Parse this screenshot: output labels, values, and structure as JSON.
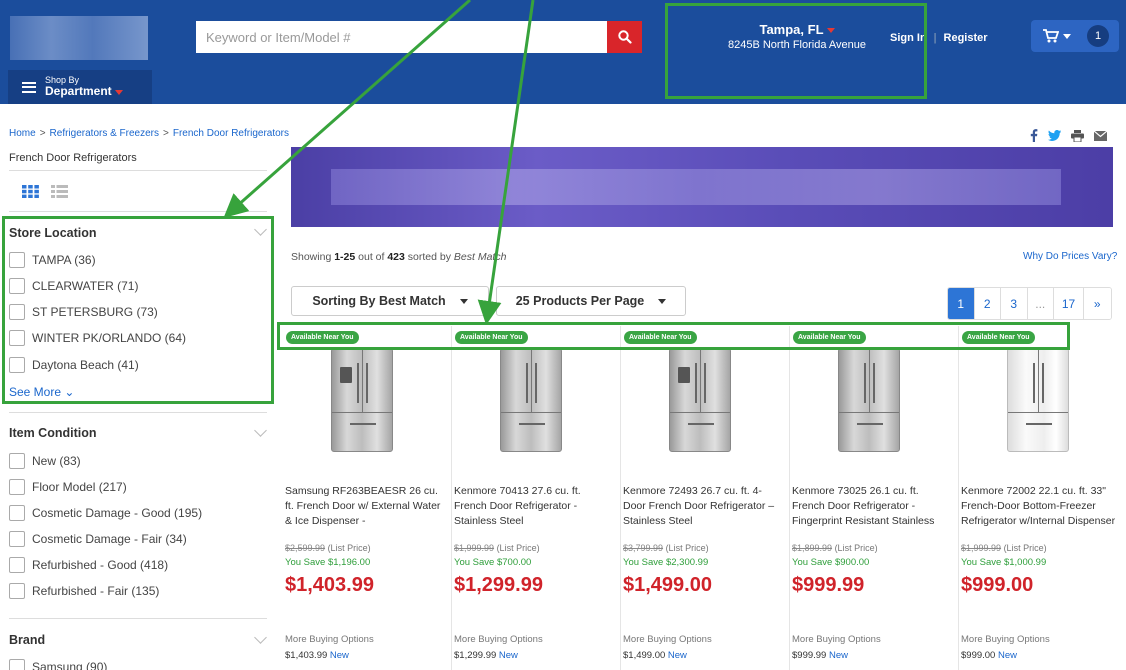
{
  "header": {
    "search_placeholder": "Keyword or Item/Model #",
    "store_city": "Tampa, FL",
    "store_address": "8245B North Florida Avenue",
    "sign_in": "Sign In",
    "register": "Register",
    "separator": "|",
    "cart_count": "1",
    "dept_small": "Shop By",
    "dept_big": "Department"
  },
  "breadcrumb": [
    "Home",
    "Refrigerators & Freezers",
    "French Door Refrigerators"
  ],
  "breadcrumb_sep": ">",
  "category_title": "French Door Refrigerators",
  "facets": {
    "store_location": {
      "title": "Store Location",
      "options": [
        "TAMPA (36)",
        "CLEARWATER (71)",
        "ST PETERSBURG (73)",
        "WINTER PK/ORLANDO (64)",
        "Daytona Beach (41)"
      ],
      "see_more": "See More ⌄"
    },
    "item_condition": {
      "title": "Item Condition",
      "options": [
        "New (83)",
        "Floor Model (217)",
        "Cosmetic Damage - Good (195)",
        "Cosmetic Damage - Fair (34)",
        "Refurbished - Good (418)",
        "Refurbished - Fair (135)"
      ]
    },
    "brand": {
      "title": "Brand",
      "options": [
        "Samsung (90)"
      ]
    }
  },
  "results": {
    "showing_prefix": "Showing",
    "range": "1-25",
    "out_of": "out of",
    "total": "423",
    "sorted_by": "sorted by",
    "sort_name": "Best Match",
    "why_prices": "Why Do Prices Vary?"
  },
  "controls": {
    "sort_label": "Sorting By Best Match",
    "per_page_label": "25 Products Per Page"
  },
  "pagination": [
    "1",
    "2",
    "3",
    "...",
    "17",
    "»"
  ],
  "products": [
    {
      "badge": "Available Near You",
      "name": "Samsung RF263BEAESR 26 cu. ft. French Door w/ External Water & Ice Dispenser -",
      "list_price": "$2,599.99",
      "list_label": "(List Price)",
      "save": "You Save $1,196.00",
      "price": "$1,403.99",
      "more_buying": "More Buying Options",
      "new_price": "$1,403.99",
      "new_label": "New"
    },
    {
      "badge": "Available Near You",
      "name": "Kenmore 70413 27.6 cu. ft. French Door Refrigerator - Stainless Steel",
      "list_price": "$1,999.99",
      "list_label": "(List Price)",
      "save": "You Save $700.00",
      "price": "$1,299.99",
      "more_buying": "More Buying Options",
      "new_price": "$1,299.99",
      "new_label": "New"
    },
    {
      "badge": "Available Near You",
      "name": "Kenmore 72493 26.7 cu. ft. 4-Door French Door Refrigerator – Stainless Steel",
      "list_price": "$3,799.99",
      "list_label": "(List Price)",
      "save": "You Save $2,300.99",
      "price": "$1,499.00",
      "more_buying": "More Buying Options",
      "new_price": "$1,499.00",
      "new_label": "New"
    },
    {
      "badge": "Available Near You",
      "name": "Kenmore 73025 26.1 cu. ft. French Door Refrigerator - Fingerprint Resistant Stainless",
      "list_price": "$1,899.99",
      "list_label": "(List Price)",
      "save": "You Save $900.00",
      "price": "$999.99",
      "more_buying": "More Buying Options",
      "new_price": "$999.99",
      "new_label": "New"
    },
    {
      "badge": "Available Near You",
      "name": "Kenmore 72002 22.1 cu. ft. 33\" French-Door Bottom-Freezer Refrigerator w/Internal Dispenser",
      "list_price": "$1,999.99",
      "list_label": "(List Price)",
      "save": "You Save $1,000.99",
      "price": "$999.00",
      "more_buying": "More Buying Options",
      "new_price": "$999.00",
      "new_label": "New"
    }
  ],
  "colors": {
    "header_blue": "#1b4d9c",
    "price_red": "#d0232a",
    "save_green": "#2e9e3a",
    "annotation_green": "#37a33c",
    "link_blue": "#1a66cc"
  }
}
